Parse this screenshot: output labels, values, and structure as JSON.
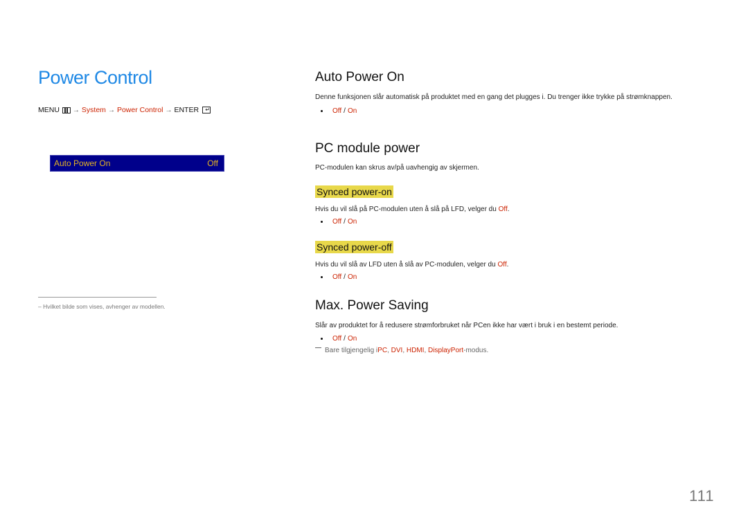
{
  "page": {
    "title": "Power Control",
    "page_number": "111"
  },
  "menu_path": {
    "menu_label": "MENU",
    "menu_icon": "menu-grid-icon",
    "arrow": "→",
    "system": "System",
    "power_control": "Power Control",
    "enter_label": "ENTER",
    "enter_icon": "enter-icon"
  },
  "osd": {
    "item_label": "Auto Power On",
    "item_value": "Off",
    "background_color": "#00008b",
    "text_color": "#e6b422"
  },
  "footnote": {
    "text": "–  Hvilket bilde som vises, avhenger av modellen."
  },
  "sections": {
    "auto_power_on": {
      "heading": "Auto Power On",
      "description": "Denne funksjonen slår automatisk på produktet med en gang det plugges i. Du trenger ikke trykke på strømknappen.",
      "opt_off": "Off",
      "opt_sep": "/",
      "opt_on": "On"
    },
    "pc_module_power": {
      "heading": "PC module power",
      "description": "PC-modulen kan skrus av/på uavhengig av skjermen.",
      "synced_on": {
        "heading": "Synced power-on",
        "description_prefix": "Hvis du vil slå på PC-modulen uten å slå på LFD, velger du ",
        "description_value": "Off",
        "description_suffix": ".",
        "opt_off": "Off",
        "opt_sep": "/",
        "opt_on": "On"
      },
      "synced_off": {
        "heading": "Synced power-off",
        "description_prefix": "Hvis du vil slå av LFD uten å slå av PC-modulen, velger du ",
        "description_value": "Off",
        "description_suffix": ".",
        "opt_off": "Off",
        "opt_sep": "/",
        "opt_on": "On"
      }
    },
    "max_power_saving": {
      "heading": "Max. Power Saving",
      "description": "Slår av produktet for å redusere strømforbruket når PCen ikke har vært i bruk i en bestemt periode.",
      "opt_off": "Off",
      "opt_sep": "/",
      "opt_on": "On",
      "note_prefix": "Bare tilgjengelig i ",
      "note_pc": "PC",
      "note_dvi": "DVI",
      "note_hdmi": "HDMI",
      "note_dp": "DisplayPort",
      "note_comma": ", ",
      "note_suffix": "-modus."
    }
  },
  "colors": {
    "title_blue": "#1e88e5",
    "accent_red": "#cc2200",
    "highlight_yellow": "#e8d84a"
  }
}
